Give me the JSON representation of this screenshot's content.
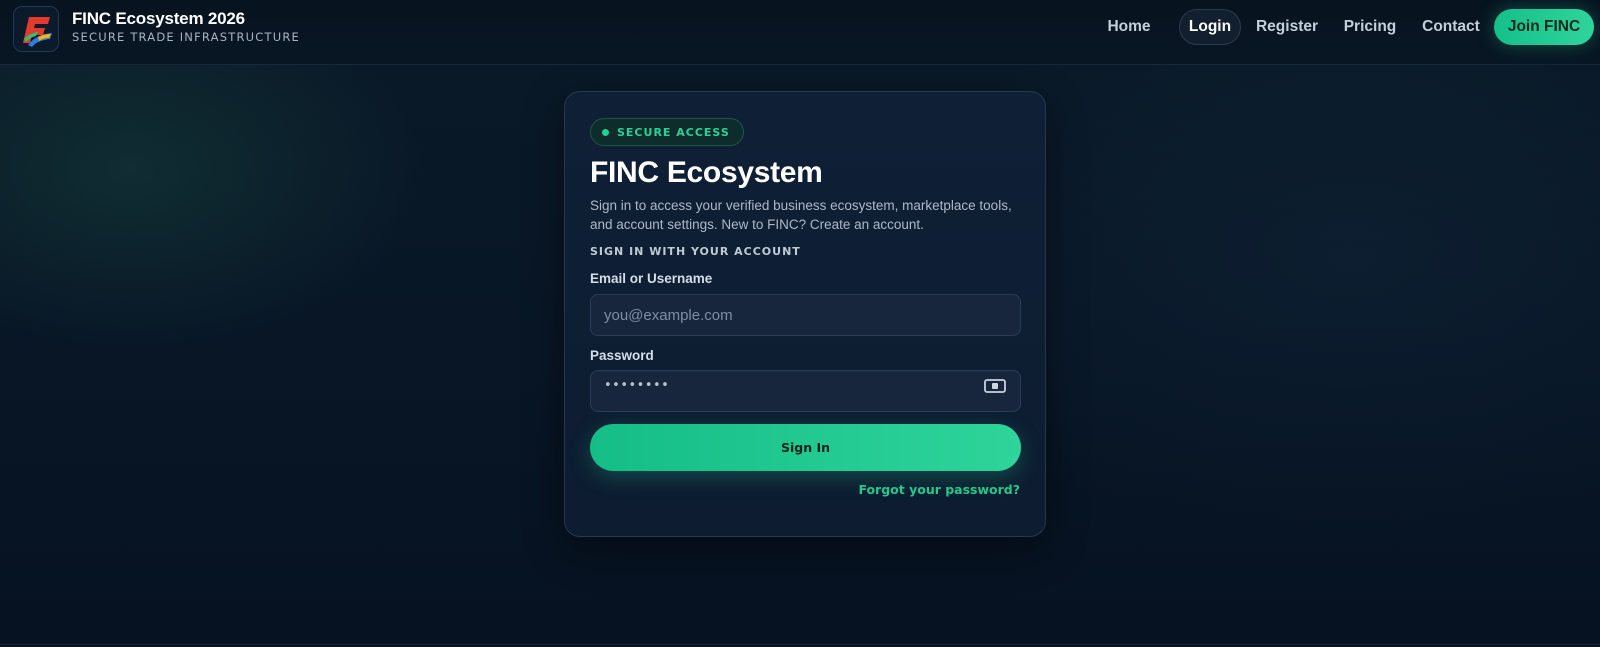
{
  "header": {
    "brand_title": "FINC Ecosystem 2026",
    "brand_subtitle": "SECURE TRADE INFRASTRUCTURE",
    "logo_icon": "finc-logo-icon"
  },
  "nav": {
    "items": [
      {
        "label": "Home",
        "active": false
      },
      {
        "label": "Login",
        "active": true
      },
      {
        "label": "Register",
        "active": false
      },
      {
        "label": "Pricing",
        "active": false
      },
      {
        "label": "Contact",
        "active": false
      }
    ],
    "cta_label": "Join FINC"
  },
  "login": {
    "badge": "SECURE ACCESS",
    "title": "FINC Ecosystem",
    "description": "Sign in to access your verified business ecosystem, marketplace tools, and account settings. New to FINC? Create an account.",
    "section_label": "SIGN IN WITH YOUR ACCOUNT",
    "email_label": "Email or Username",
    "email_placeholder": "you@example.com",
    "password_label": "Password",
    "password_masked": "••••••••",
    "toggle_icon": "eye-toggle-icon",
    "submit_label": "Sign In",
    "forgot_label": "Forgot your password?"
  },
  "colors": {
    "accent": "#1fc98e",
    "background": "#081626",
    "card": "#0f2036"
  }
}
